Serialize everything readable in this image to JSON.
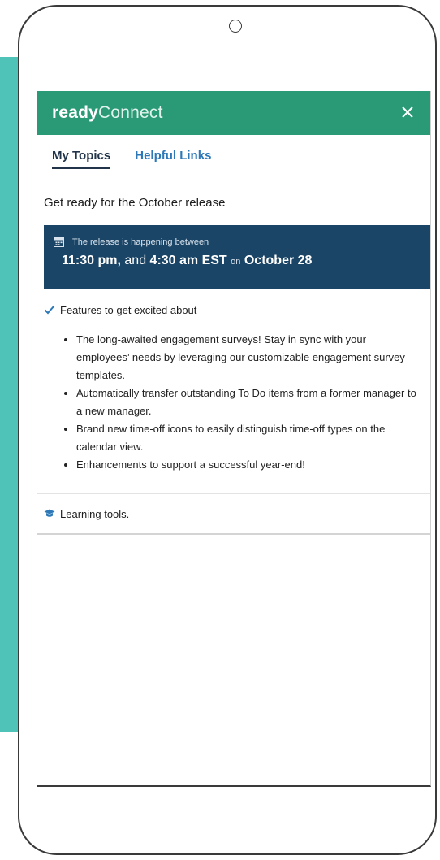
{
  "header": {
    "brand_bold": "ready",
    "brand_light": "Connect"
  },
  "tabs": [
    {
      "label": "My Topics",
      "active": true
    },
    {
      "label": "Helpful Links",
      "active": false
    }
  ],
  "release": {
    "title": "Get ready for the October release",
    "banner_intro": "The release is happening between",
    "start_time": "11:30 pm,",
    "and_word": "and",
    "end_time": "4:30 am EST",
    "on_word": "on",
    "date": "October 28"
  },
  "features": {
    "title": "Features to get excited about",
    "items": [
      "The long-awaited engagement surveys! Stay in sync with your employees’ needs by leveraging our customizable engagement survey templates.",
      "Automatically transfer outstanding To Do items from a former manager to a new manager.",
      "Brand new time-off icons to easily distinguish time-off types on the calendar view.",
      "Enhancements to support a successful year-end!"
    ]
  },
  "learning": {
    "label": "Learning tools."
  },
  "colors": {
    "header_green": "#2a9a76",
    "banner_navy": "#1b4567",
    "link_blue": "#2d79b8",
    "check_blue": "#2d79b8",
    "teal_backdrop": "#4fc3b8"
  },
  "icons": {
    "close": "close-icon",
    "calendar": "calendar-icon",
    "check": "check-icon",
    "learning": "graduation-cap-icon"
  }
}
